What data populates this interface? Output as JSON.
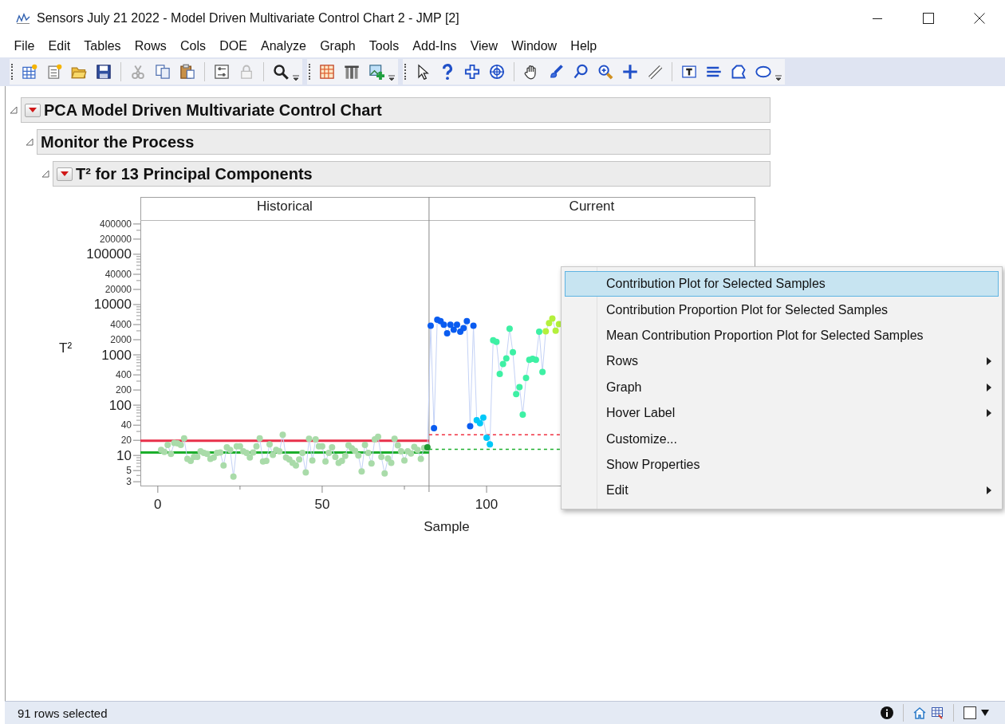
{
  "window": {
    "title": "Sensors July 21 2022 - Model Driven Multivariate Control Chart 2 - JMP [2]"
  },
  "menu_bar": [
    "File",
    "Edit",
    "Tables",
    "Rows",
    "Cols",
    "DOE",
    "Analyze",
    "Graph",
    "Tools",
    "Add-Ins",
    "View",
    "Window",
    "Help"
  ],
  "report": {
    "title": "PCA Model Driven Multivariate Control Chart",
    "expanded": true,
    "menu_button": true,
    "children": [
      {
        "title": "Monitor the Process",
        "expanded": true,
        "menu_button": false,
        "children": [
          {
            "title": "T² for 13 Principal Components",
            "expanded": true,
            "menu_button": true
          }
        ]
      }
    ]
  },
  "chart": {
    "panels": [
      {
        "label": "Historical"
      },
      {
        "label": "Current"
      }
    ],
    "y_axis_title": "T²",
    "x_axis_title": "Sample",
    "y_tick_labels": [
      "400000",
      "200000",
      "100000",
      "40000",
      "20000",
      "10000",
      "4000",
      "2000",
      "1000",
      "400",
      "200",
      "100",
      "40",
      "20",
      "10",
      "5",
      "3"
    ],
    "x_tick_labels": [
      "0",
      "50",
      "100"
    ]
  },
  "context_menu": {
    "items": [
      {
        "label": "Contribution Plot for Selected Samples",
        "selected": true,
        "submenu": false
      },
      {
        "label": "Contribution Proportion Plot for Selected Samples",
        "selected": false,
        "submenu": false
      },
      {
        "label": "Mean Contribution Proportion Plot for Selected Samples",
        "selected": false,
        "submenu": false
      },
      {
        "label": "Rows",
        "selected": false,
        "submenu": true
      },
      {
        "label": "Graph",
        "selected": false,
        "submenu": true
      },
      {
        "label": "Hover Label",
        "selected": false,
        "submenu": true
      },
      {
        "label": "Customize...",
        "selected": false,
        "submenu": false
      },
      {
        "label": "Show Properties",
        "selected": false,
        "submenu": false
      },
      {
        "label": "Edit",
        "selected": false,
        "submenu": true
      }
    ]
  },
  "status_bar": {
    "text": "91 rows selected"
  }
}
